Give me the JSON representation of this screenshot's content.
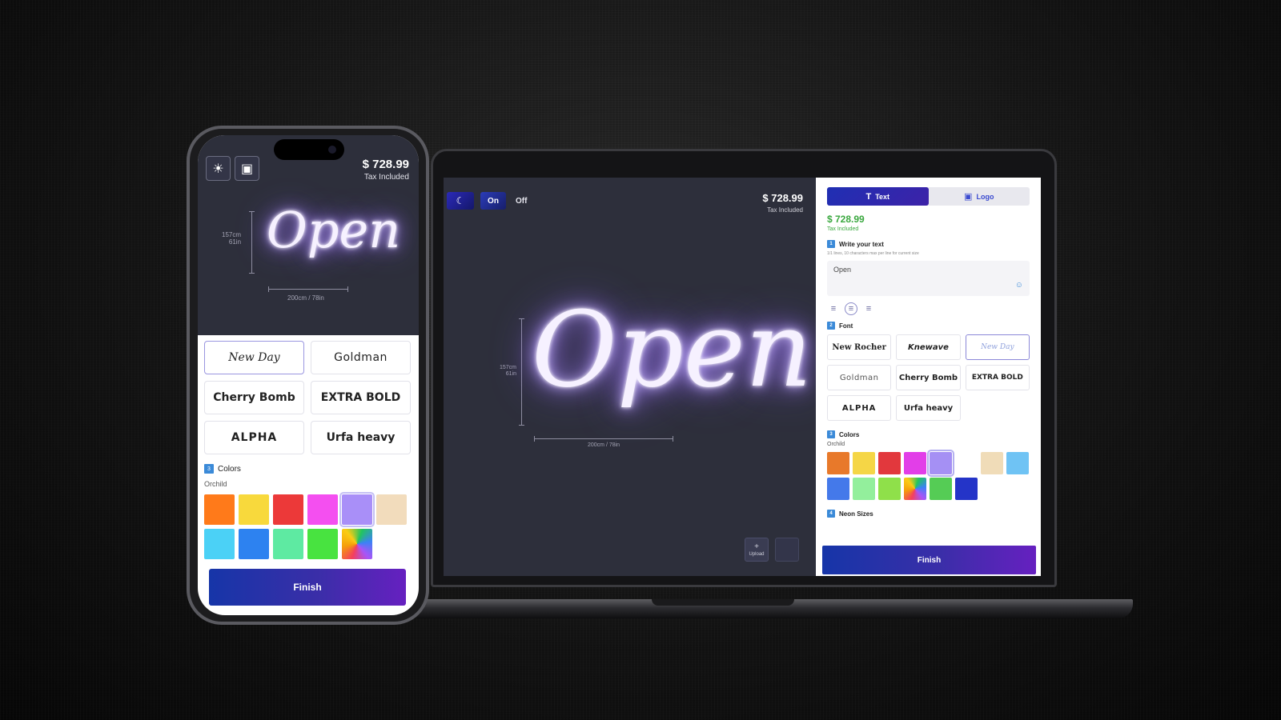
{
  "shared": {
    "price": "$ 728.99",
    "tax": "Tax Included",
    "neon_text": "Open",
    "height_cm": "157cm",
    "height_in": "61in",
    "width_label": "200cm / 78in",
    "finish_label": "Finish",
    "selected_color_name": "Orchild"
  },
  "laptop": {
    "toggle_on": "On",
    "toggle_off": "Off",
    "upload_label": "Upload",
    "tabs": [
      {
        "label": "Text",
        "icon": "text-icon"
      },
      {
        "label": "Logo",
        "icon": "image-icon"
      }
    ],
    "sections": {
      "write": {
        "num": "1",
        "title": "Write your text",
        "hint": "1/1 lines, 10 characters max per line for current size"
      },
      "font": {
        "num": "2",
        "title": "Font"
      },
      "colors": {
        "num": "3",
        "title": "Colors"
      },
      "sizes": {
        "num": "4",
        "title": "Neon Sizes"
      }
    },
    "text_value": "Open",
    "fonts": [
      "New Rocher",
      "Knewave",
      "New Day",
      "Goldman",
      "Cherry Bomb",
      "EXTRA BOLD",
      "ALPHA",
      "Urfa heavy"
    ],
    "selected_font": "New Day",
    "colors": [
      "#e8792a",
      "#f5d646",
      "#e2383d",
      "#e23ee8",
      "#a590f4",
      "#ffffff",
      "#f0dcb8",
      "#6fc3f4",
      "#4479ea",
      "#93ef9c",
      "#8fe04a",
      "rainbow",
      "#55cc55",
      "#2434c8"
    ],
    "selected_color": "#a590f4"
  },
  "phone": {
    "fonts": [
      "New Day",
      "Goldman",
      "Cherry Bomb",
      "EXTRA BOLD",
      "ALPHA",
      "Urfa heavy"
    ],
    "selected_font": "New Day",
    "section_colors": {
      "num": "3",
      "title": "Colors"
    },
    "colors": [
      "#ff7a1a",
      "#f8d93c",
      "#ec3939",
      "#f44ff0",
      "#a98ff8",
      "#f2dcbc",
      "#4bd1f6",
      "#2d82f0",
      "#5eeaa2",
      "#48e340",
      "rainbow"
    ],
    "selected_color": "#a98ff8"
  },
  "colors": {
    "accent_green": "#3aa83f",
    "accent_blue": "#3b8ad8",
    "finish_from": "#1635a8",
    "finish_to": "#6620c0"
  }
}
